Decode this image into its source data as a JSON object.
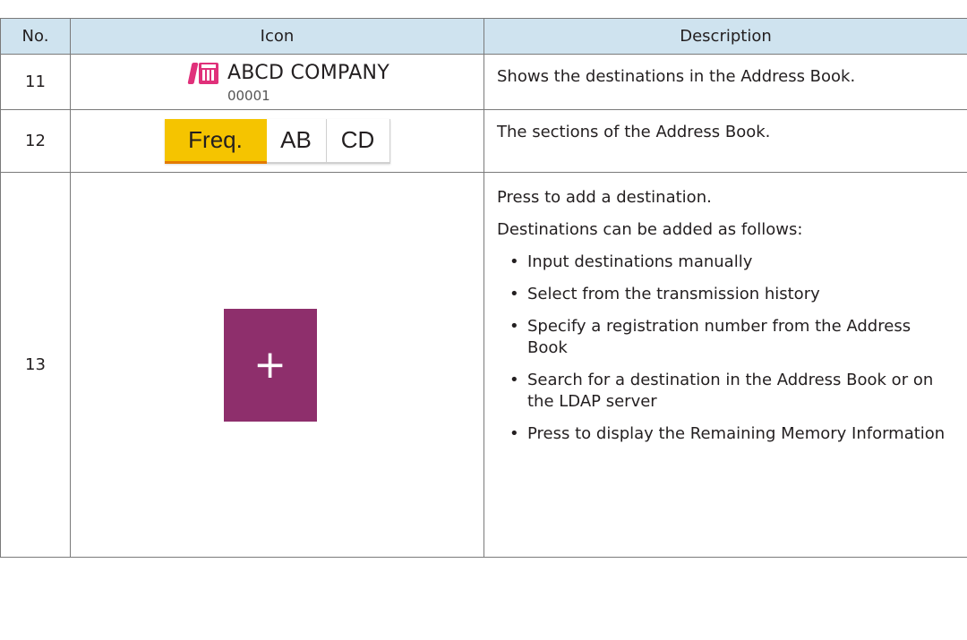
{
  "header": {
    "no": "No.",
    "icon": "Icon",
    "description": "Description"
  },
  "rows": [
    {
      "no": "11",
      "icon": {
        "name": "fax-icon",
        "company": "ABCD COMPANY",
        "reg_number": "00001",
        "color": "#e0307a"
      },
      "description": "Shows the destinations in the Address Book."
    },
    {
      "no": "12",
      "icon": {
        "tabs": [
          "Freq.",
          "AB",
          "CD"
        ],
        "active_tab": "Freq.",
        "active_color": "#f5c400"
      },
      "description": "The sections of the Address Book."
    },
    {
      "no": "13",
      "icon": {
        "name": "plus-icon",
        "glyph": "+",
        "color": "#8e2f6c"
      },
      "description": "Press to add a destination.",
      "intro": "Destinations can be added as follows:",
      "bullets": [
        "Input destinations manually",
        "Select from the transmission history",
        "Specify a registration number from the Address Book",
        "Search for a destination in the Address Book or on the LDAP server",
        "Press to display the Remaining Memory Information"
      ]
    }
  ]
}
